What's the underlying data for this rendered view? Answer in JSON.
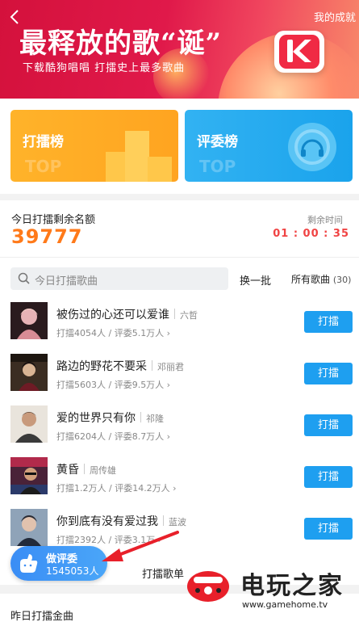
{
  "banner": {
    "title": "最释放的歌“诞”",
    "subtitle": "下载酷狗唱唱 打擂史上最多歌曲",
    "my_results": "我的成就"
  },
  "cards": [
    {
      "label": "打擂榜",
      "watermark": "TOP",
      "color": "#ffa820"
    },
    {
      "label": "评委榜",
      "watermark": "TOP",
      "color": "#23aaf0"
    }
  ],
  "quota": {
    "label": "今日打擂剩余名额",
    "value": "39777",
    "time_label": "剩余时间",
    "time_value": "01 : 00 : 35"
  },
  "search": {
    "placeholder": "今日打擂歌曲"
  },
  "actions": {
    "refresh": "换一批",
    "all_songs": "所有歌曲",
    "all_songs_count": "(30)"
  },
  "songs": [
    {
      "title": "被伤过的心还可以爱谁",
      "artist": "六哲",
      "stats": "打擂4054人 / 评委5.1万人",
      "button": "打擂"
    },
    {
      "title": "路边的野花不要采",
      "artist": "邓丽君",
      "stats": "打擂5603人 / 评委9.5万人",
      "button": "打擂"
    },
    {
      "title": "爱的世界只有你",
      "artist": "祁隆",
      "stats": "打擂6204人 / 评委8.7万人",
      "button": "打擂"
    },
    {
      "title": "黄昏",
      "artist": "周传雄",
      "stats": "打擂1.2万人 / 评委14.2万人",
      "button": "打擂"
    },
    {
      "title": "你到底有没有爱过我",
      "artist": "蓝波",
      "stats": "打擂2392人 / 评委3.1万",
      "button": "打擂"
    }
  ],
  "judge": {
    "label": "做评委",
    "count": "1545053人"
  },
  "vote_list": "打擂歌单",
  "yesterday": {
    "label": "昨日打擂金曲"
  },
  "watermark": {
    "name": "电玩之家",
    "url": "www.gamehome.tv"
  },
  "colors": {
    "accent_orange": "#ff7a1a",
    "accent_blue": "#1e9ff0",
    "timer_red": "#f04343",
    "banner_red": "#e0194a"
  }
}
